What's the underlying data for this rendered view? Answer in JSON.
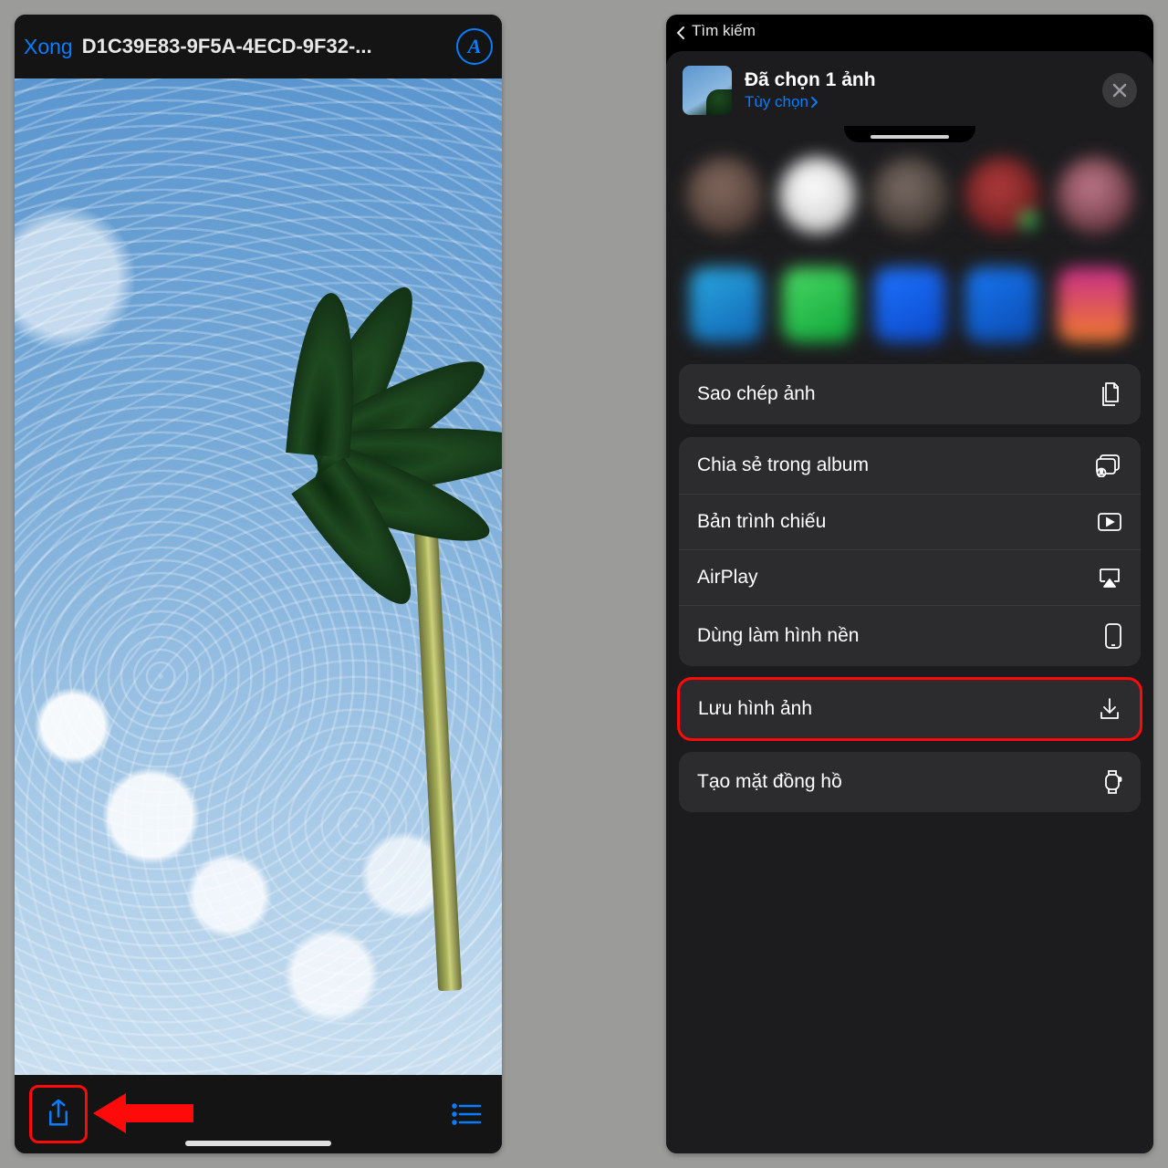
{
  "left_panel": {
    "done_label": "Xong",
    "file_name": "D1C39E83-9F5A-4ECD-9F32-...",
    "markup_badge": "A"
  },
  "right_panel": {
    "status_back_label": "Tìm kiếm",
    "header": {
      "title": "Đã chọn 1 ảnh",
      "options_label": "Tùy chọn"
    },
    "actions": {
      "copy_photo": "Sao chép ảnh",
      "share_album": "Chia sẻ trong album",
      "slideshow": "Bản trình chiếu",
      "airplay": "AirPlay",
      "use_wallpaper": "Dùng làm hình nền",
      "save_image": "Lưu hình ảnh",
      "create_watchface": "Tạo mặt đồng hồ"
    }
  }
}
